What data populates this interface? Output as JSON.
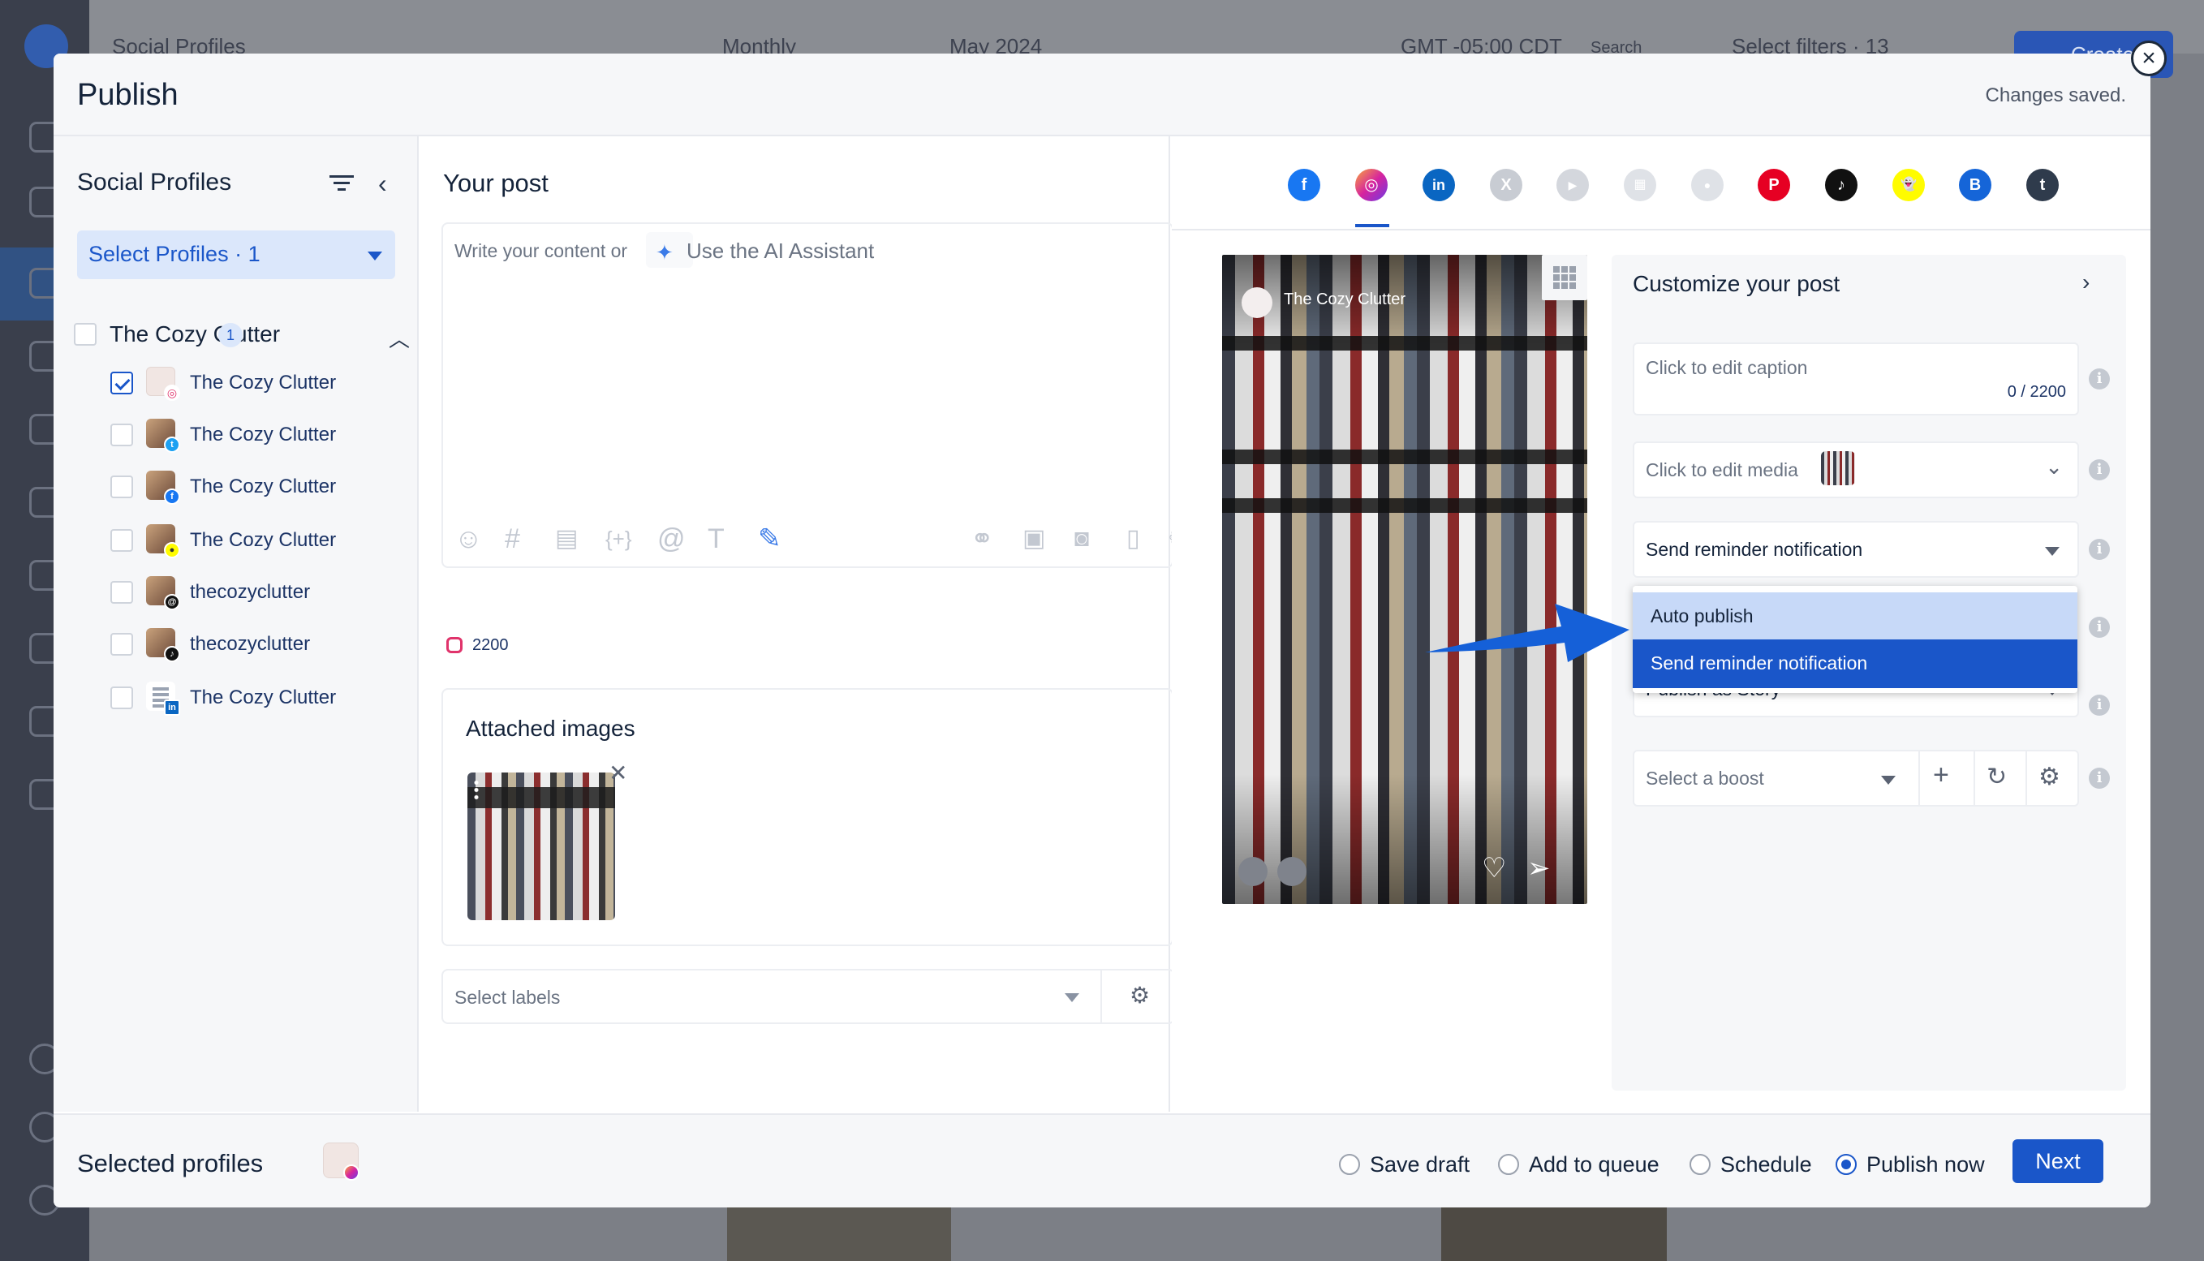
{
  "background": {
    "title": "Social Profiles",
    "view": "Monthly",
    "month": "May 2024",
    "timezone": "GMT -05:00 CDT",
    "search": "Search",
    "filters": "Select filters · 13",
    "create": "Create"
  },
  "modal": {
    "title": "Publish",
    "status": "Changes saved."
  },
  "left": {
    "title": "Social Profiles",
    "select_profiles": "Select Profiles · 1",
    "group": {
      "name": "The Cozy Clutter",
      "count": "1"
    },
    "profiles": [
      {
        "name": "The Cozy Clutter",
        "network": "instagram",
        "checked": true,
        "warning": true
      },
      {
        "name": "The Cozy Clutter",
        "network": "twitter",
        "checked": false
      },
      {
        "name": "The Cozy Clutter",
        "network": "facebook",
        "checked": false
      },
      {
        "name": "The Cozy Clutter",
        "network": "snapchat",
        "checked": false
      },
      {
        "name": "thecozyclutter",
        "network": "threads",
        "checked": false
      },
      {
        "name": "thecozyclutter",
        "network": "tiktok",
        "checked": false
      },
      {
        "name": "The Cozy Clutter",
        "network": "linkedin",
        "checked": false
      }
    ]
  },
  "post": {
    "title": "Your post",
    "placeholder": "Write your content or",
    "ai_assistant": "Use the AI Assistant",
    "char_count": "2200",
    "attached_title": "Attached images",
    "labels_placeholder": "Select labels"
  },
  "networks": [
    {
      "name": "facebook",
      "color": "#1877f2",
      "glyph": "f"
    },
    {
      "name": "instagram",
      "color": "#d6249f",
      "glyph": "◎",
      "active": true
    },
    {
      "name": "linkedin",
      "color": "#0a66c2",
      "glyph": "in"
    },
    {
      "name": "x",
      "color": "#c8ccd3",
      "glyph": "X"
    },
    {
      "name": "youtube",
      "color": "#d4d7dd",
      "glyph": "▶"
    },
    {
      "name": "google-business",
      "color": "#dfe2e7",
      "glyph": "▦"
    },
    {
      "name": "reddit",
      "color": "#dfe2e7",
      "glyph": "●"
    },
    {
      "name": "pinterest",
      "color": "#e60023",
      "glyph": "P"
    },
    {
      "name": "tiktok",
      "color": "#111111",
      "glyph": "♪"
    },
    {
      "name": "snapchat",
      "color": "#fffc00",
      "glyph": "👻"
    },
    {
      "name": "bluesky-b",
      "color": "#1565d8",
      "glyph": "B"
    },
    {
      "name": "tumblr",
      "color": "#2f3b4c",
      "glyph": "t"
    }
  ],
  "preview": {
    "username": "The Cozy Clutter"
  },
  "customize": {
    "title": "Customize your post",
    "caption_placeholder": "Click to edit caption",
    "caption_count": "0 / 2200",
    "media_placeholder": "Click to edit media",
    "publish_mode": "Send reminder notification",
    "dropdown_options": [
      "Auto publish",
      "Send reminder notification"
    ],
    "post_type": "Publish as Story",
    "boost_placeholder": "Select a boost"
  },
  "footer": {
    "selected_profiles": "Selected profiles",
    "options": [
      {
        "label": "Save draft",
        "selected": false
      },
      {
        "label": "Add to queue",
        "selected": false
      },
      {
        "label": "Schedule",
        "selected": false
      },
      {
        "label": "Publish now",
        "selected": true
      }
    ],
    "next": "Next"
  }
}
